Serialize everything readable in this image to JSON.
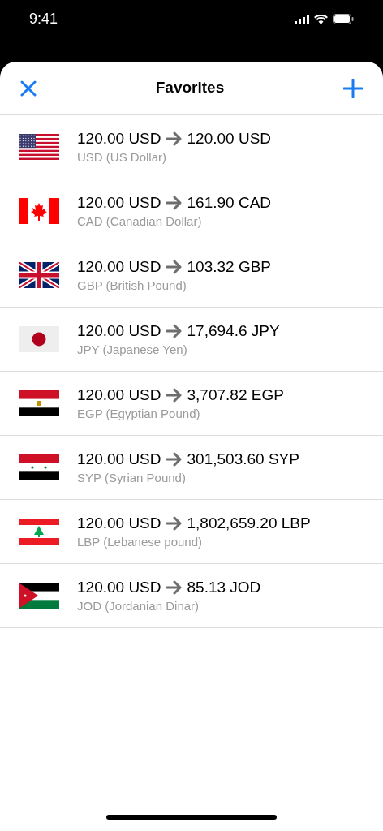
{
  "status_bar": {
    "time": "9:41"
  },
  "header": {
    "title": "Favorites"
  },
  "favorites": [
    {
      "kind": "us",
      "amount": "120.00 USD",
      "result": "120.00 USD",
      "name": "USD (US Dollar)"
    },
    {
      "kind": "ca",
      "amount": "120.00 USD",
      "result": "161.90 CAD",
      "name": "CAD (Canadian Dollar)"
    },
    {
      "kind": "gb",
      "amount": "120.00 USD",
      "result": "103.32 GBP",
      "name": "GBP (British Pound)"
    },
    {
      "kind": "jp",
      "amount": "120.00 USD",
      "result": "17,694.6 JPY",
      "name": "JPY (Japanese Yen)"
    },
    {
      "kind": "eg",
      "amount": "120.00 USD",
      "result": "3,707.82 EGP",
      "name": "EGP (Egyptian Pound)"
    },
    {
      "kind": "sy",
      "amount": "120.00 USD",
      "result": "301,503.60 SYP",
      "name": "SYP (Syrian Pound)"
    },
    {
      "kind": "lb",
      "amount": "120.00 USD",
      "result": "1,802,659.20 LBP",
      "name": "LBP (Lebanese pound)"
    },
    {
      "kind": "jo",
      "amount": "120.00 USD",
      "result": "85.13 JOD",
      "name": "JOD (Jordanian Dinar)"
    }
  ]
}
